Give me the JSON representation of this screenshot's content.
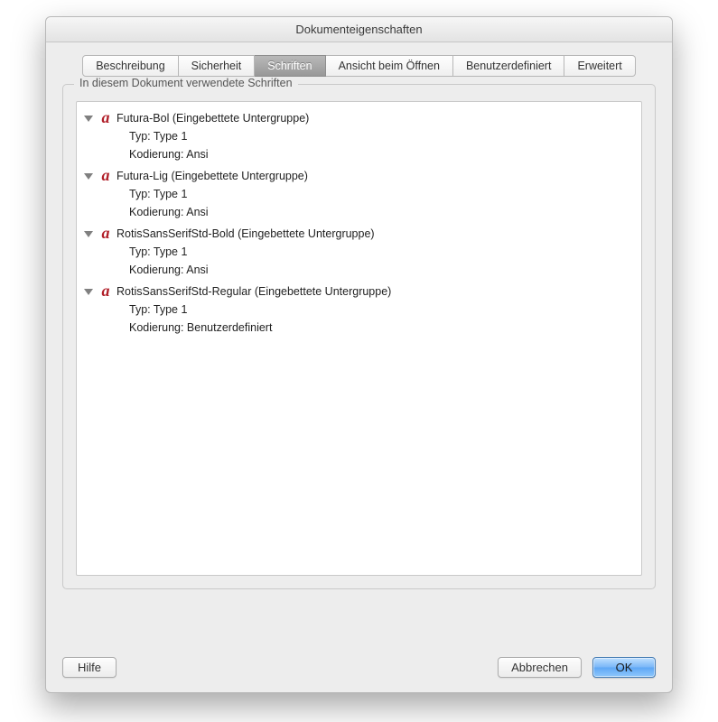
{
  "window": {
    "title": "Dokumenteigenschaften"
  },
  "tabs": [
    {
      "label": "Beschreibung",
      "selected": false
    },
    {
      "label": "Sicherheit",
      "selected": false
    },
    {
      "label": "Schriften",
      "selected": true
    },
    {
      "label": "Ansicht beim Öffnen",
      "selected": false
    },
    {
      "label": "Benutzerdefiniert",
      "selected": false
    },
    {
      "label": "Erweitert",
      "selected": false
    }
  ],
  "group": {
    "title": "In diesem Dokument verwendete Schriften"
  },
  "labels": {
    "type": "Typ:",
    "encoding": "Kodierung:"
  },
  "fonts": [
    {
      "name": "Futura-Bol (Eingebettete Untergruppe)",
      "type": "Type 1",
      "encoding": "Ansi"
    },
    {
      "name": "Futura-Lig (Eingebettete Untergruppe)",
      "type": "Type 1",
      "encoding": "Ansi"
    },
    {
      "name": "RotisSansSerifStd-Bold (Eingebettete Untergruppe)",
      "type": "Type 1",
      "encoding": "Ansi"
    },
    {
      "name": "RotisSansSerifStd-Regular (Eingebettete Untergruppe)",
      "type": "Type 1",
      "encoding": "Benutzerdefiniert"
    }
  ],
  "buttons": {
    "help": "Hilfe",
    "cancel": "Abbrechen",
    "ok": "OK"
  }
}
